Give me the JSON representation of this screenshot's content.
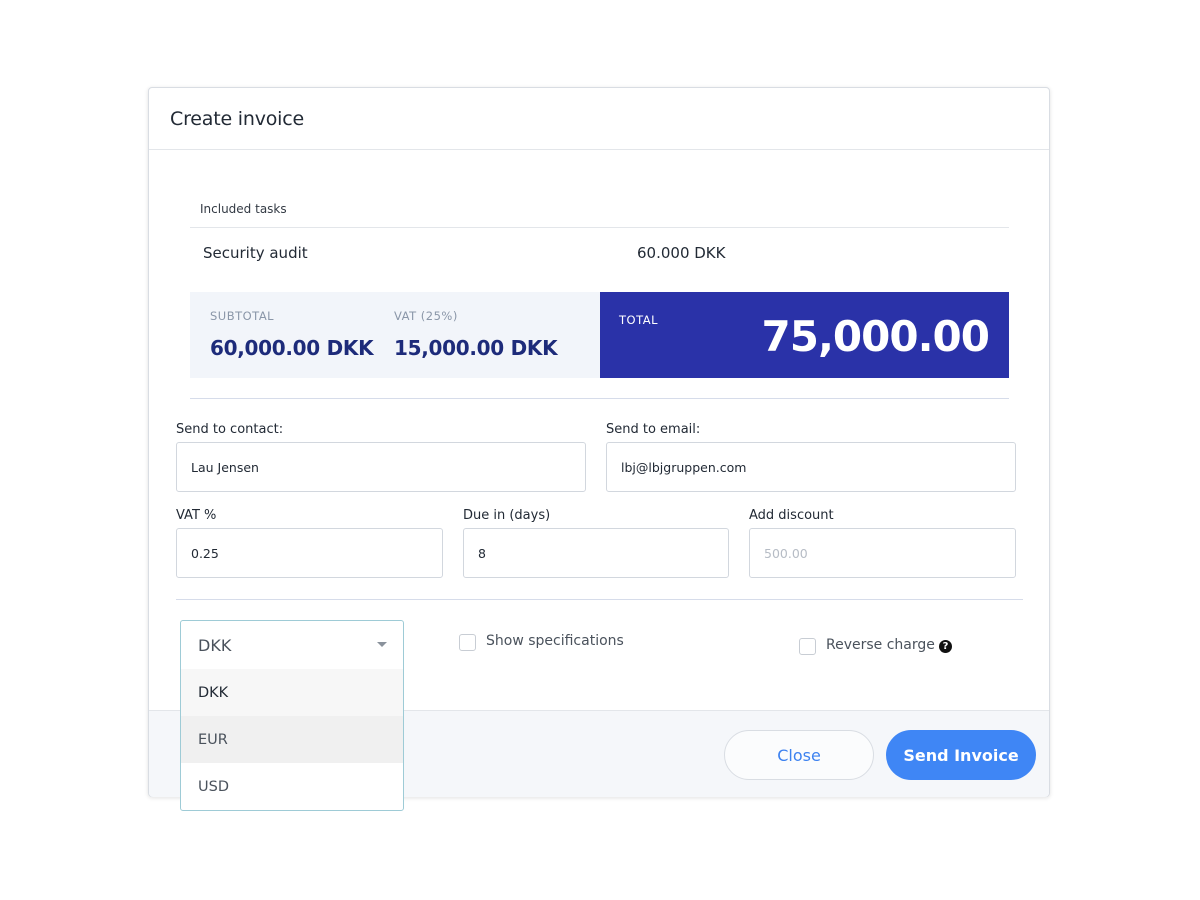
{
  "modal": {
    "title": "Create invoice"
  },
  "tasks": {
    "label": "Included tasks",
    "items": [
      {
        "name": "Security audit",
        "price": "60.000 DKK"
      }
    ]
  },
  "summary": {
    "subtotal_label": "SUBTOTAL",
    "subtotal_value": "60,000.00 DKK",
    "vat_label": "VAT (25%)",
    "vat_value": "15,000.00 DKK",
    "total_label": "TOTAL",
    "total_value": "75,000.00"
  },
  "form": {
    "contact_label": "Send to contact:",
    "contact_value": "Lau Jensen",
    "email_label": "Send to email:",
    "email_value": "lbj@lbjgruppen.com",
    "vat_label": "VAT %",
    "vat_value": "0.25",
    "due_label": "Due in (days)",
    "due_value": "8",
    "discount_label": "Add discount",
    "discount_placeholder": "500.00"
  },
  "options": {
    "show_specifications_label": "Show specifications",
    "reverse_charge_label": "Reverse charge",
    "help_glyph": "?"
  },
  "currency": {
    "selected": "DKK",
    "options": [
      "DKK",
      "EUR",
      "USD"
    ]
  },
  "footer": {
    "close_label": "Close",
    "send_label": "Send Invoice"
  },
  "colors": {
    "total_bg": "#2a32a8",
    "subtotal_bg": "#f2f5fa",
    "primary_button": "#3f86f5",
    "link_blue": "#3d82f0"
  }
}
